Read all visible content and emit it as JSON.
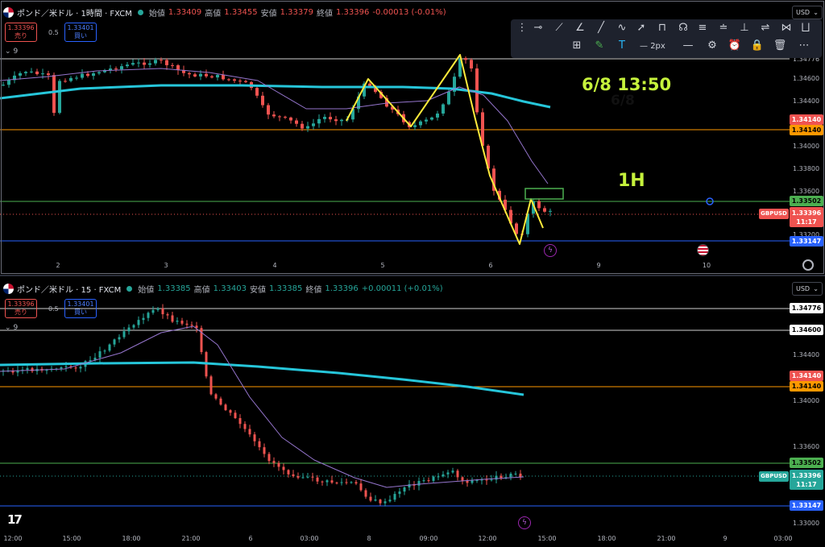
{
  "chart_top": {
    "symbol": "ポンド／米ドル · 1時間 · FXCM",
    "ohlc": {
      "open_label": "始値",
      "open": "1.33409",
      "high_label": "高値",
      "high": "1.33455",
      "low_label": "安値",
      "low": "1.33379",
      "close_label": "終値",
      "close": "1.33396",
      "change": "-0.00013 (-0.01%)"
    },
    "sell": {
      "price": "1.33396",
      "label": "売り"
    },
    "buy": {
      "price": "1.33401",
      "label": "買い"
    },
    "spread": "0.5",
    "indicator_count": "9",
    "currency": "USD",
    "price_labels": [
      "1.34776",
      "1.34600",
      "1.34400",
      "1.34000",
      "1.33800",
      "1.33600",
      "1.33200"
    ],
    "level_boxes": {
      "pink": "1.34140",
      "orange": "1.34140",
      "green": "1.33502",
      "blue": "1.33147"
    },
    "current": {
      "symbol": "GBPUSD",
      "price": "1.33396",
      "countdown": "11:17"
    },
    "time_labels": [
      "2",
      "3",
      "4",
      "5",
      "6",
      "9",
      "10"
    ],
    "annotation_date": "6/8 13:50",
    "annotation_date_shadow": "6/8",
    "annotation_tf": "1H",
    "colors": {
      "up": "#26a69a",
      "down": "#ef5350",
      "ma_slow": "#26c6da",
      "ma_fast": "#9575cd",
      "orange": "#ff9800",
      "green": "#4caf50",
      "blue": "#2962ff",
      "yellow": "#ffeb3b",
      "annot": "#c6f23c"
    }
  },
  "toolbar": {
    "width_label": "2px",
    "tools": [
      "horizontal-ray",
      "ray",
      "trend-angle",
      "trend-line",
      "path",
      "arrow-marker",
      "frame",
      "curve",
      "fib",
      "measure",
      "projection",
      "object-tree",
      "pencil",
      "text",
      "line-width",
      "minus",
      "settings",
      "alert",
      "lock",
      "delete",
      "more"
    ]
  },
  "chart_bottom": {
    "symbol": "ポンド／米ドル · 15 · FXCM",
    "ohlc": {
      "open_label": "始値",
      "open": "1.33385",
      "high_label": "高値",
      "high": "1.33403",
      "low_label": "安値",
      "low": "1.33385",
      "close_label": "終値",
      "close": "1.33396",
      "change": "+0.00011 (+0.01%)"
    },
    "sell": {
      "price": "1.33396",
      "label": "売り"
    },
    "buy": {
      "price": "1.33401",
      "label": "買い"
    },
    "spread": "0.5",
    "indicator_count": "9",
    "currency": "USD",
    "price_labels": [
      "1.34400",
      "1.34000",
      "1.33600",
      "1.33000"
    ],
    "level_boxes": {
      "white1": "1.34776",
      "white2": "1.34600",
      "pink": "1.34140",
      "orange": "1.34140",
      "green": "1.33502",
      "blue": "1.33147"
    },
    "current": {
      "symbol": "GBPUSD",
      "price": "1.33396",
      "countdown": "11:17"
    },
    "time_labels": [
      "12:00",
      "15:00",
      "18:00",
      "21:00",
      "6",
      "03:00",
      "8",
      "09:00",
      "12:00",
      "15:00",
      "18:00",
      "21:00",
      "9",
      "03:00"
    ]
  }
}
